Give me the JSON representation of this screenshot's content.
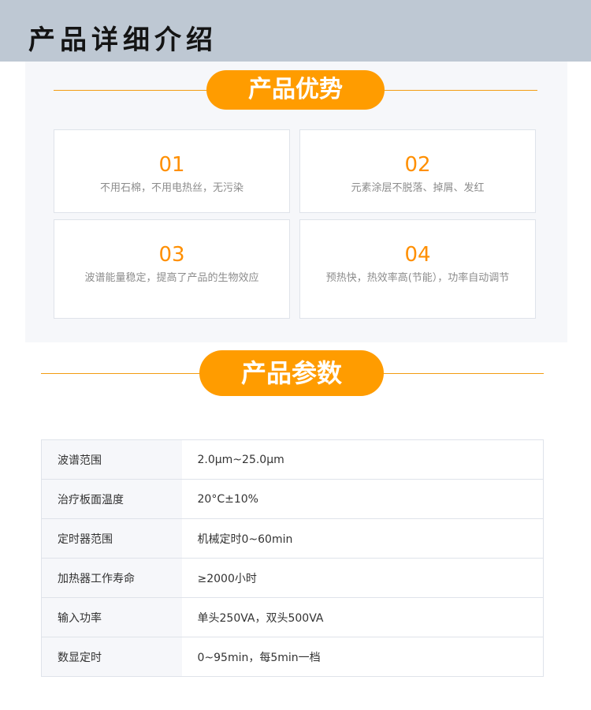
{
  "header": {
    "title": "产品详细介绍"
  },
  "advantages": {
    "heading": "产品优势",
    "items": [
      {
        "num": "01",
        "text": "不用石棉，不用电热丝，无污染"
      },
      {
        "num": "02",
        "text": "元素涂层不脱落、掉屑、发红"
      },
      {
        "num": "03",
        "text": "波谱能量稳定，提高了产品的生物效应"
      },
      {
        "num": "04",
        "text": "预热快，热效率高(节能），功率自动调节"
      }
    ]
  },
  "params": {
    "heading": "产品参数",
    "rows": [
      {
        "key": "波谱范围",
        "value": "2.0μm~25.0μm"
      },
      {
        "key": "治疗板面温度",
        "value": "20°C±10%"
      },
      {
        "key": "定时器范围",
        "value": "机械定时0~60min"
      },
      {
        "key": "加热器工作寿命",
        "value": "≥2000小时"
      },
      {
        "key": "输入功率",
        "value": "单头250VA，双头500VA"
      },
      {
        "key": "数显定时",
        "value": "0~95min，每5min一档"
      }
    ]
  },
  "colors": {
    "accent": "#ff9c00",
    "header_bg": "#bec8d3",
    "panel_bg": "#f6f7fa"
  }
}
